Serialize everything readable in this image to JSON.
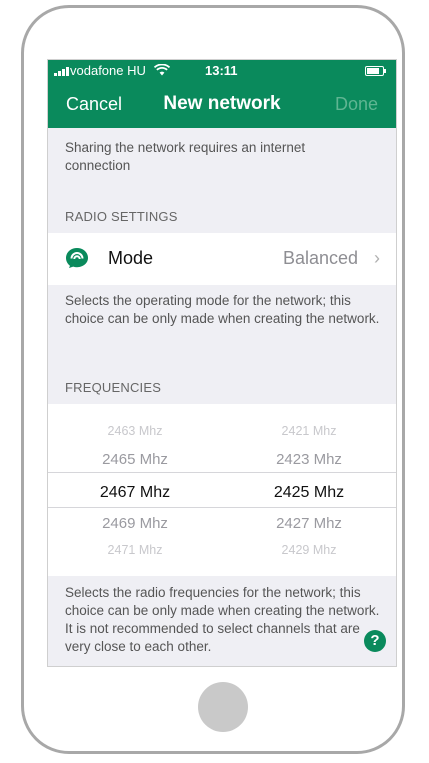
{
  "status": {
    "carrier": "vodafone HU",
    "time": "13:11"
  },
  "nav": {
    "cancel": "Cancel",
    "title": "New network",
    "done": "Done"
  },
  "sharing_note": "Sharing the network requires an internet connection",
  "radio_settings": {
    "header": "RADIO SETTINGS",
    "mode_label": "Mode",
    "mode_value": "Balanced",
    "mode_description": "Selects the operating mode for the network; this choice can be only made when creating the network."
  },
  "frequencies": {
    "header": "FREQUENCIES",
    "left_column": [
      "2463 Mhz",
      "2465 Mhz",
      "2467 Mhz",
      "2469 Mhz",
      "2471 Mhz"
    ],
    "right_column": [
      "2421 Mhz",
      "2423 Mhz",
      "2425 Mhz",
      "2427 Mhz",
      "2429 Mhz"
    ],
    "description": "Selects the radio frequencies for the network; this choice can be only made when creating the network. It is not recommended to select channels that are very close to each other."
  },
  "help_label": "?",
  "colors": {
    "accent": "#0a8a5c",
    "background": "#efeff4"
  }
}
